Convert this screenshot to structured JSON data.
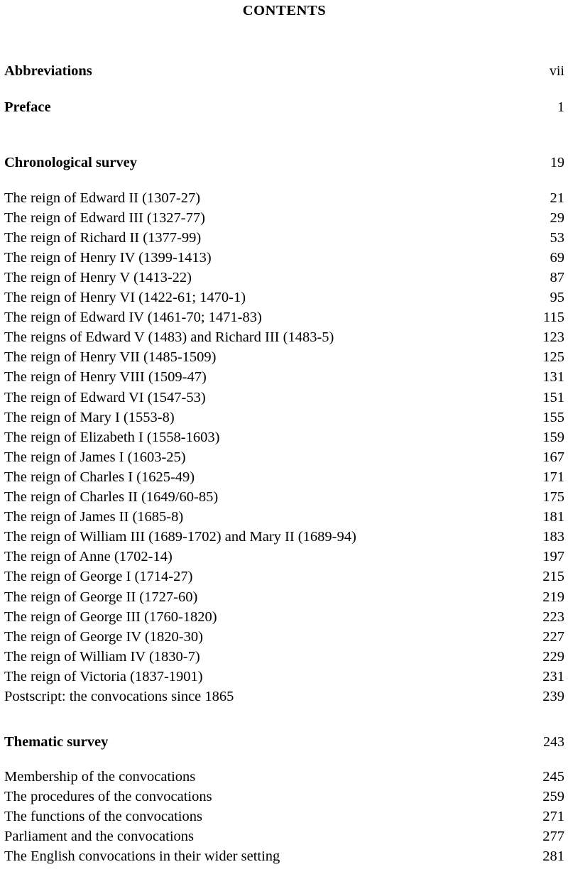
{
  "document": {
    "title": "CONTENTS"
  },
  "front_matter": [
    {
      "label": "Abbreviations",
      "page": "vii"
    },
    {
      "label": "Preface",
      "page": "1"
    }
  ],
  "sections": [
    {
      "heading": {
        "label": "Chronological survey",
        "page": "19"
      },
      "entries": [
        {
          "label": "The reign of Edward II (1307-27)",
          "page": "21"
        },
        {
          "label": "The reign of Edward III (1327-77)",
          "page": "29"
        },
        {
          "label": "The reign of Richard II (1377-99)",
          "page": "53"
        },
        {
          "label": "The reign of Henry IV (1399-1413)",
          "page": "69"
        },
        {
          "label": "The reign of Henry V (1413-22)",
          "page": "87"
        },
        {
          "label": "The reign of Henry VI (1422-61; 1470-1)",
          "page": "95"
        },
        {
          "label": "The reign of Edward IV (1461-70; 1471-83)",
          "page": "115"
        },
        {
          "label": "The reigns of Edward V (1483) and Richard III (1483-5)",
          "page": "123"
        },
        {
          "label": "The reign of Henry VII (1485-1509)",
          "page": "125"
        },
        {
          "label": "The reign of Henry VIII (1509-47)",
          "page": "131"
        },
        {
          "label": "The reign of Edward VI (1547-53)",
          "page": "151"
        },
        {
          "label": "The reign of Mary I (1553-8)",
          "page": "155"
        },
        {
          "label": "The reign of Elizabeth I (1558-1603)",
          "page": "159"
        },
        {
          "label": "The reign of James I (1603-25)",
          "page": "167"
        },
        {
          "label": "The reign of Charles I (1625-49)",
          "page": "171"
        },
        {
          "label": "The reign of Charles II (1649/60-85)",
          "page": "175"
        },
        {
          "label": "The reign of James II (1685-8)",
          "page": "181"
        },
        {
          "label": "The reign of William III (1689-1702) and Mary II (1689-94)",
          "page": "183"
        },
        {
          "label": "The reign of Anne (1702-14)",
          "page": "197"
        },
        {
          "label": "The reign of George I (1714-27)",
          "page": "215"
        },
        {
          "label": "The reign of George II (1727-60)",
          "page": "219"
        },
        {
          "label": "The reign of George III (1760-1820)",
          "page": "223"
        },
        {
          "label": "The reign of George IV (1820-30)",
          "page": "227"
        },
        {
          "label": "The reign of William IV (1830-7)",
          "page": "229"
        },
        {
          "label": "The reign of Victoria (1837-1901)",
          "page": "231"
        },
        {
          "label": "Postscript: the convocations since 1865",
          "page": "239"
        }
      ]
    },
    {
      "heading": {
        "label": "Thematic survey",
        "page": "243"
      },
      "entries": [
        {
          "label": "Membership of the convocations",
          "page": "245"
        },
        {
          "label": "The procedures of the convocations",
          "page": "259"
        },
        {
          "label": "The functions of the convocations",
          "page": "271"
        },
        {
          "label": "Parliament and the convocations",
          "page": "277"
        },
        {
          "label": "The English convocations in their wider setting",
          "page": "281"
        }
      ]
    }
  ]
}
